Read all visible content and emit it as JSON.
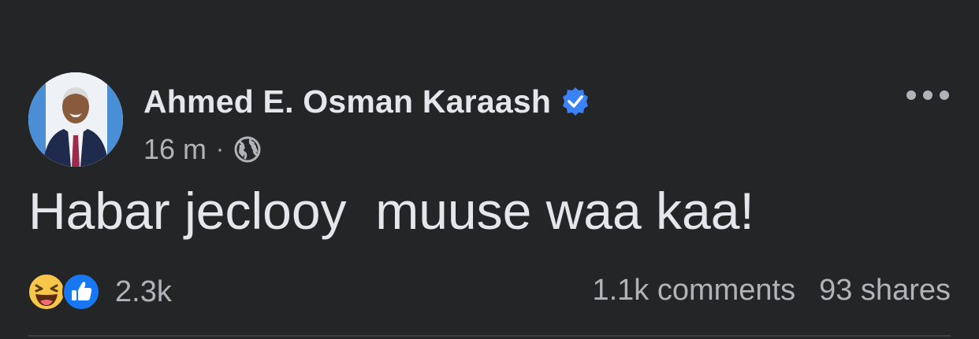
{
  "post": {
    "author": {
      "name": "Ahmed E. Osman Karaash",
      "verified": true,
      "verified_color": "#3b82f6"
    },
    "meta": {
      "time": "16 m",
      "separator": "·",
      "audience_icon": "globe-icon"
    },
    "more_icon": "more-horizontal-icon",
    "text": "Habar jeclooy  muuse waa kaa!",
    "reactions": {
      "types": [
        "haha",
        "like"
      ],
      "count": "2.3k"
    },
    "stats": {
      "comments": "1.1k comments",
      "shares": "93 shares"
    }
  },
  "colors": {
    "background": "#242526",
    "primary_text": "#e4e6eb",
    "secondary_text": "#b0b3b8",
    "like_blue": "#1877f2",
    "haha_yellow": "#f7c74a"
  }
}
